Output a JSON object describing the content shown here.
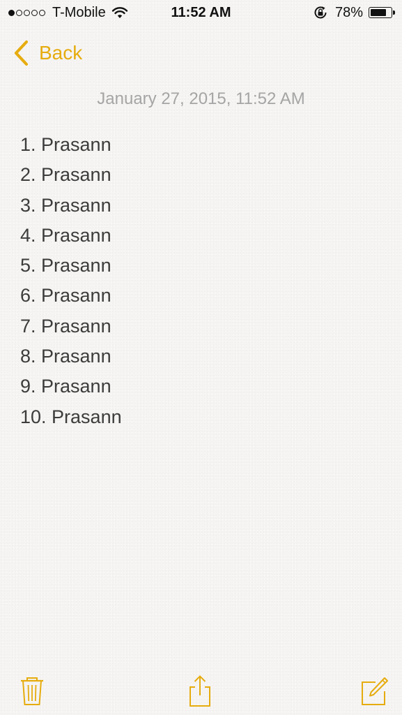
{
  "status_bar": {
    "signal_dots": [
      true,
      false,
      false,
      false,
      false
    ],
    "carrier": "T-Mobile",
    "time": "11:52 AM",
    "battery_percent": "78%",
    "battery_level": 0.78
  },
  "nav": {
    "back_label": "Back"
  },
  "note": {
    "date": "January 27, 2015, 11:52 AM",
    "lines": [
      "1. Prasann",
      "2. Prasann",
      "3. Prasann",
      "4. Prasann",
      "5. Prasann",
      "6. Prasann",
      "7. Prasann",
      "8. Prasann",
      "9. Prasann",
      "10. Prasann"
    ]
  },
  "toolbar": {
    "items": [
      "trash-icon",
      "share-icon",
      "compose-icon"
    ]
  },
  "colors": {
    "accent": "#e6ac0f",
    "background": "#f5f4f2",
    "text": "#3c3c3c",
    "date_text": "#a5a5a5"
  }
}
